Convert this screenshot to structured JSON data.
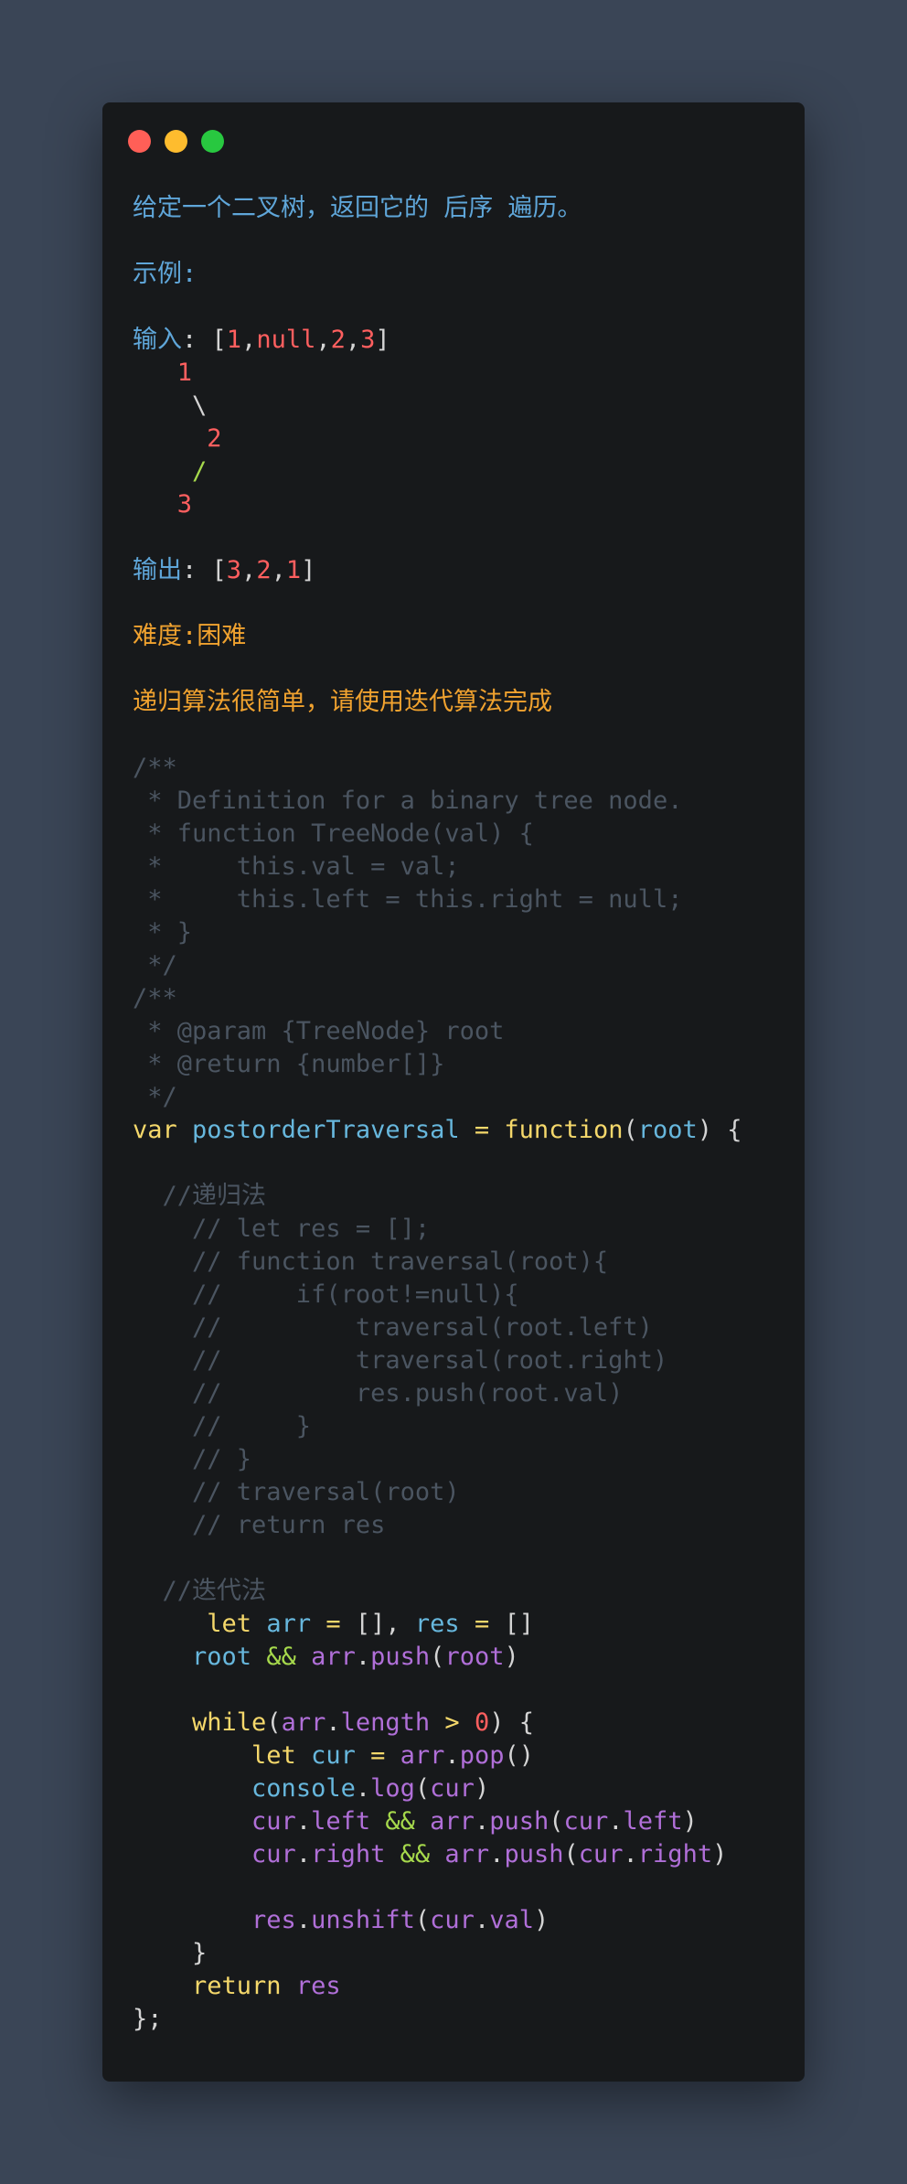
{
  "window": {
    "buttons": [
      "close",
      "minimize",
      "maximize"
    ]
  },
  "code_lines": [
    [
      [
        "cn",
        "给定一个二叉树，返回它的 后序 遍历。"
      ]
    ],
    [],
    [
      [
        "cn",
        "示例:"
      ]
    ],
    [],
    [
      [
        "cn",
        "输入"
      ],
      [
        "pl",
        ": ["
      ],
      [
        "nm",
        "1"
      ],
      [
        "pl",
        ","
      ],
      [
        "nm",
        "null"
      ],
      [
        "pl",
        ","
      ],
      [
        "nm",
        "2"
      ],
      [
        "pl",
        ","
      ],
      [
        "nm",
        "3"
      ],
      [
        "pl",
        "]"
      ]
    ],
    [
      [
        "pl",
        "   "
      ],
      [
        "nm",
        "1"
      ]
    ],
    [
      [
        "pl",
        "    \\"
      ]
    ],
    [
      [
        "pl",
        "     "
      ],
      [
        "nm",
        "2"
      ]
    ],
    [
      [
        "pl",
        "    "
      ],
      [
        "gr",
        "/"
      ]
    ],
    [
      [
        "pl",
        "   "
      ],
      [
        "nm",
        "3"
      ]
    ],
    [],
    [
      [
        "cn",
        "输出"
      ],
      [
        "pl",
        ": ["
      ],
      [
        "nm",
        "3"
      ],
      [
        "pl",
        ","
      ],
      [
        "nm",
        "2"
      ],
      [
        "pl",
        ","
      ],
      [
        "nm",
        "1"
      ],
      [
        "pl",
        "]"
      ]
    ],
    [],
    [
      [
        "or",
        "难度:困难"
      ]
    ],
    [],
    [
      [
        "or",
        "递归算法很简单，请使用迭代算法完成"
      ]
    ],
    [],
    [
      [
        "cm",
        "/**"
      ]
    ],
    [
      [
        "cm",
        " * Definition for a binary tree node."
      ]
    ],
    [
      [
        "cm",
        " * function TreeNode(val) {"
      ]
    ],
    [
      [
        "cm",
        " *     this.val = val;"
      ]
    ],
    [
      [
        "cm",
        " *     this.left = this.right = null;"
      ]
    ],
    [
      [
        "cm",
        " * }"
      ]
    ],
    [
      [
        "cm",
        " */"
      ]
    ],
    [
      [
        "cm",
        "/**"
      ]
    ],
    [
      [
        "cm",
        " * @param {TreeNode} root"
      ]
    ],
    [
      [
        "cm",
        " * @return {number[]}"
      ]
    ],
    [
      [
        "cm",
        " */"
      ]
    ],
    [
      [
        "kw",
        "var "
      ],
      [
        "fn",
        "postorderTraversal"
      ],
      [
        "op",
        " = "
      ],
      [
        "kw",
        "function"
      ],
      [
        "pl",
        "("
      ],
      [
        "fn",
        "root"
      ],
      [
        "pl",
        ") {"
      ]
    ],
    [],
    [
      [
        "cm",
        "  //递归法"
      ]
    ],
    [
      [
        "cm",
        "    // let res = [];"
      ]
    ],
    [
      [
        "cm",
        "    // function traversal(root){"
      ]
    ],
    [
      [
        "cm",
        "    //     if(root!=null){"
      ]
    ],
    [
      [
        "cm",
        "    //         traversal(root.left)"
      ]
    ],
    [
      [
        "cm",
        "    //         traversal(root.right)"
      ]
    ],
    [
      [
        "cm",
        "    //         res.push(root.val)"
      ]
    ],
    [
      [
        "cm",
        "    //     }"
      ]
    ],
    [
      [
        "cm",
        "    // }"
      ]
    ],
    [
      [
        "cm",
        "    // traversal(root)"
      ]
    ],
    [
      [
        "cm",
        "    // return res"
      ]
    ],
    [],
    [
      [
        "cm",
        "  //迭代法"
      ]
    ],
    [
      [
        "pl",
        "     "
      ],
      [
        "kw",
        "let "
      ],
      [
        "fn",
        "arr"
      ],
      [
        "op",
        " = "
      ],
      [
        "pl",
        "[], "
      ],
      [
        "fn",
        "res"
      ],
      [
        "op",
        " = "
      ],
      [
        "pl",
        "[]"
      ]
    ],
    [
      [
        "pl",
        "    "
      ],
      [
        "fn",
        "root"
      ],
      [
        "gr",
        " && "
      ],
      [
        "id",
        "arr"
      ],
      [
        "pl",
        "."
      ],
      [
        "id",
        "push"
      ],
      [
        "pl",
        "("
      ],
      [
        "id",
        "root"
      ],
      [
        "pl",
        ")"
      ]
    ],
    [],
    [
      [
        "pl",
        "    "
      ],
      [
        "kw",
        "while"
      ],
      [
        "pl",
        "("
      ],
      [
        "id",
        "arr"
      ],
      [
        "pl",
        "."
      ],
      [
        "id",
        "length"
      ],
      [
        "op",
        " > "
      ],
      [
        "nm",
        "0"
      ],
      [
        "pl",
        ") {"
      ]
    ],
    [
      [
        "pl",
        "        "
      ],
      [
        "kw",
        "let "
      ],
      [
        "fn",
        "cur"
      ],
      [
        "op",
        " = "
      ],
      [
        "id",
        "arr"
      ],
      [
        "pl",
        "."
      ],
      [
        "id",
        "pop"
      ],
      [
        "pl",
        "()"
      ]
    ],
    [
      [
        "pl",
        "        "
      ],
      [
        "fn",
        "console"
      ],
      [
        "pl",
        "."
      ],
      [
        "id",
        "log"
      ],
      [
        "pl",
        "("
      ],
      [
        "id",
        "cur"
      ],
      [
        "pl",
        ")"
      ]
    ],
    [
      [
        "pl",
        "        "
      ],
      [
        "id",
        "cur"
      ],
      [
        "pl",
        "."
      ],
      [
        "id",
        "left"
      ],
      [
        "gr",
        " && "
      ],
      [
        "id",
        "arr"
      ],
      [
        "pl",
        "."
      ],
      [
        "id",
        "push"
      ],
      [
        "pl",
        "("
      ],
      [
        "id",
        "cur"
      ],
      [
        "pl",
        "."
      ],
      [
        "id",
        "left"
      ],
      [
        "pl",
        ")"
      ]
    ],
    [
      [
        "pl",
        "        "
      ],
      [
        "id",
        "cur"
      ],
      [
        "pl",
        "."
      ],
      [
        "id",
        "right"
      ],
      [
        "gr",
        " && "
      ],
      [
        "id",
        "arr"
      ],
      [
        "pl",
        "."
      ],
      [
        "id",
        "push"
      ],
      [
        "pl",
        "("
      ],
      [
        "id",
        "cur"
      ],
      [
        "pl",
        "."
      ],
      [
        "id",
        "right"
      ],
      [
        "pl",
        ")"
      ]
    ],
    [],
    [
      [
        "pl",
        "        "
      ],
      [
        "id",
        "res"
      ],
      [
        "pl",
        "."
      ],
      [
        "id",
        "unshift"
      ],
      [
        "pl",
        "("
      ],
      [
        "id",
        "cur"
      ],
      [
        "pl",
        "."
      ],
      [
        "id",
        "val"
      ],
      [
        "pl",
        ")"
      ]
    ],
    [
      [
        "pl",
        "    }"
      ]
    ],
    [
      [
        "pl",
        "    "
      ],
      [
        "kw",
        "return "
      ],
      [
        "id",
        "res"
      ]
    ],
    [
      [
        "pl",
        "};"
      ]
    ]
  ]
}
